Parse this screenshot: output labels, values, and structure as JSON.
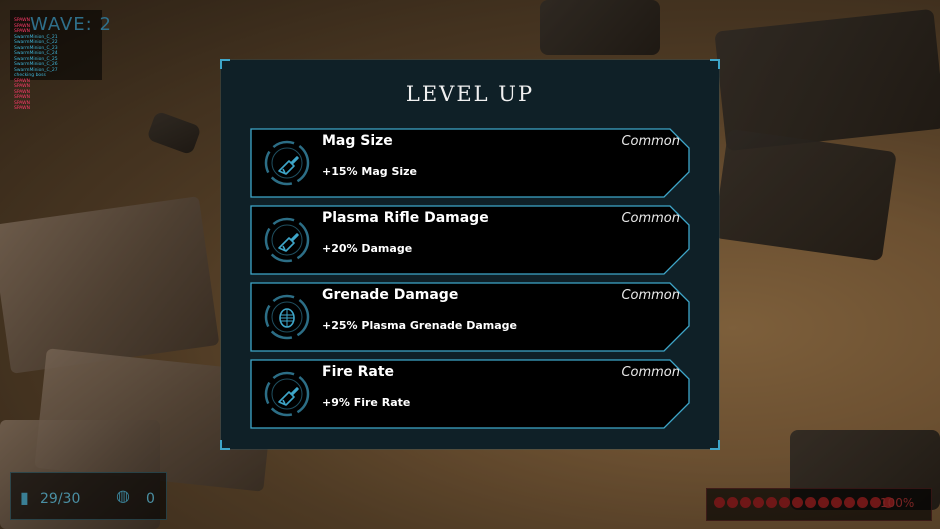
{
  "hud": {
    "wave_label": "WAVE: 2",
    "debug_lines": [
      {
        "text": "SPAWN",
        "color": "red"
      },
      {
        "text": "SPAWN",
        "color": "red"
      },
      {
        "text": "SPAWN",
        "color": "red"
      },
      {
        "text": "SwarmMinion_C_21",
        "color": "blue"
      },
      {
        "text": "SwarmMinion_C_22",
        "color": "blue"
      },
      {
        "text": "SwarmMinion_C_23",
        "color": "blue"
      },
      {
        "text": "SwarmMinion_C_24",
        "color": "blue"
      },
      {
        "text": "SwarmMinion_C_25",
        "color": "blue"
      },
      {
        "text": "SwarmMinion_C_26",
        "color": "blue"
      },
      {
        "text": "SwarmMinion_C_27",
        "color": "blue"
      },
      {
        "text": "checking boss",
        "color": "blue"
      },
      {
        "text": "SPAWN",
        "color": "red"
      },
      {
        "text": "SPAWN",
        "color": "red"
      },
      {
        "text": "SPAWN",
        "color": "red"
      },
      {
        "text": "SPAWN",
        "color": "red"
      },
      {
        "text": "SPAWN",
        "color": "red"
      },
      {
        "text": "SPAWN",
        "color": "red"
      }
    ],
    "ammo": "29/30",
    "grenades": "0",
    "health_percent": "100%",
    "health_pips": 14
  },
  "level_up": {
    "title": "LEVEL UP",
    "upgrades": [
      {
        "name": "Mag Size",
        "rarity": "Common",
        "description": "+15% Mag Size",
        "icon": "rifle-icon"
      },
      {
        "name": "Plasma Rifle Damage",
        "rarity": "Common",
        "description": "+20% Damage",
        "icon": "rifle-icon"
      },
      {
        "name": "Grenade Damage",
        "rarity": "Common",
        "description": "+25% Plasma Grenade Damage",
        "icon": "grenade-icon"
      },
      {
        "name": "Fire Rate",
        "rarity": "Common",
        "description": "+9% Fire Rate",
        "icon": "rifle-icon"
      }
    ]
  },
  "colors": {
    "accent": "#3ea6c9",
    "panel": "#0f2027",
    "card": "#000000"
  }
}
